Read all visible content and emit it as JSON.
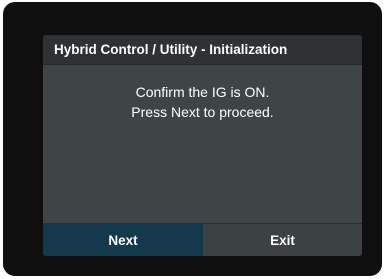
{
  "dialog": {
    "title": "Hybrid Control / Utility - Initialization",
    "message_lines": [
      "Confirm the IG is ON.",
      "Press Next to proceed."
    ],
    "buttons": {
      "next_label": "Next",
      "exit_label": "Exit"
    }
  },
  "colors": {
    "bezel": "#0f0f0f",
    "screen_background": "#3f4547",
    "titlebar_background": "#2e3234",
    "next_button_selected": "#14384c",
    "exit_button": "#3c4244",
    "text": "#ffffff"
  }
}
